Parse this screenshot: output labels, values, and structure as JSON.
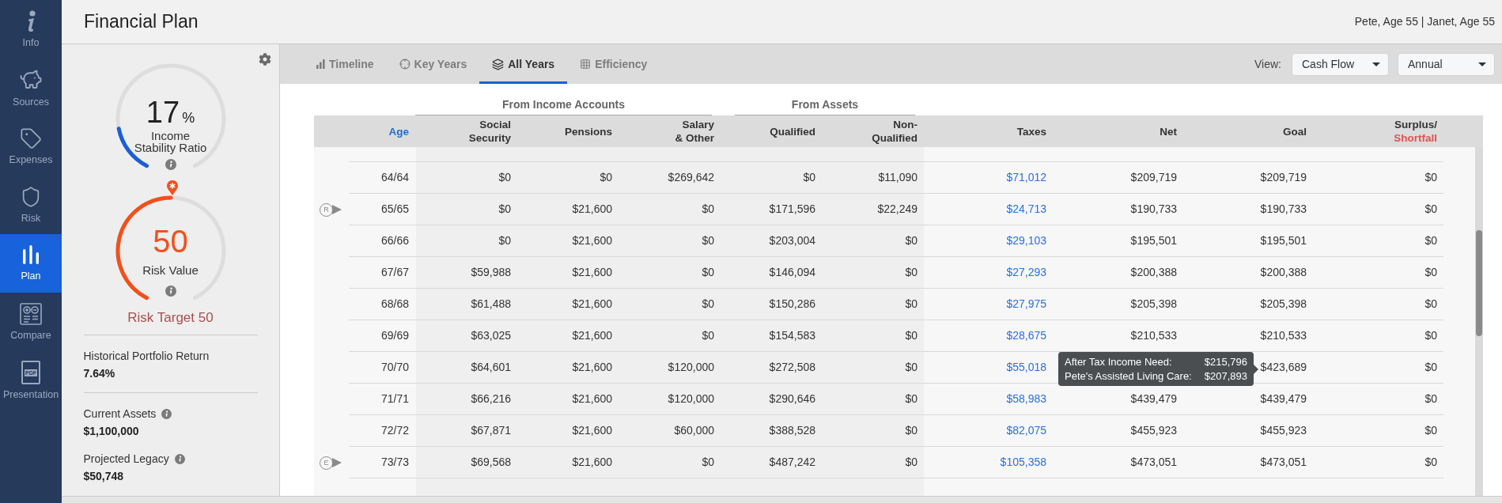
{
  "nav": {
    "items": [
      {
        "label": "Info",
        "selected": false
      },
      {
        "label": "Sources",
        "selected": false
      },
      {
        "label": "Expenses",
        "selected": false
      },
      {
        "label": "Risk",
        "selected": false
      },
      {
        "label": "Plan",
        "selected": true
      },
      {
        "label": "Compare",
        "selected": false
      },
      {
        "label": "Presentation",
        "selected": false,
        "icon_text": "PDF"
      }
    ]
  },
  "header": {
    "title": "Financial Plan",
    "clients": "Pete, Age 55 | Janet, Age 55"
  },
  "summary": {
    "income_stability": {
      "value": "17",
      "unit": "%",
      "label_lines": [
        "Income",
        "Stability Ratio"
      ],
      "level": 0.17
    },
    "risk": {
      "value": "50",
      "label": "Risk Value",
      "level": 0.5
    },
    "risk_target": "Risk Target 50",
    "stat_groups": [
      [
        {
          "label": "Historical Portfolio Return",
          "value": "7.64%",
          "info": false
        }
      ],
      [
        {
          "label": "Current Assets",
          "value": "$1,100,000",
          "info": true
        },
        {
          "label": "Projected Legacy",
          "value": "$50,748",
          "info": true
        }
      ]
    ]
  },
  "tabs": [
    {
      "label": "Timeline",
      "selected": false
    },
    {
      "label": "Key Years",
      "selected": false
    },
    {
      "label": "All Years",
      "selected": true
    },
    {
      "label": "Efficiency",
      "selected": false
    }
  ],
  "view": {
    "label": "View:",
    "selects": [
      {
        "value": "Cash Flow"
      },
      {
        "value": "Annual"
      }
    ]
  },
  "table": {
    "groups": [
      {
        "label": "From Income Accounts"
      },
      {
        "label": "From Assets"
      }
    ],
    "columns": [
      {
        "lines": [
          "Age"
        ],
        "kind": "accent"
      },
      {
        "lines": [
          "Social",
          "Security"
        ],
        "kind": "plain"
      },
      {
        "lines": [
          "Pensions"
        ],
        "kind": "plain"
      },
      {
        "lines": [
          "Salary",
          "& Other"
        ],
        "kind": "plain"
      },
      {
        "lines": [
          "Qualified"
        ],
        "kind": "plain"
      },
      {
        "lines": [
          "Non-",
          "Qualified"
        ],
        "kind": "plain"
      },
      {
        "lines": [
          "Taxes"
        ],
        "kind": "link"
      },
      {
        "lines": [
          "Net"
        ],
        "kind": "plain"
      },
      {
        "lines": [
          "Goal"
        ],
        "kind": "plain"
      },
      {
        "lines": [
          "Surplus/"
        ],
        "negative_label": "Shortfall",
        "kind": "plain"
      }
    ],
    "rows": [
      {
        "cells": [
          "64/64",
          "$0",
          "$0",
          "$269,642",
          "$0",
          "$11,090",
          "$71,012",
          "$209,719",
          "$209,719",
          "$0"
        ]
      },
      {
        "cells": [
          "65/65",
          "$0",
          "$21,600",
          "$0",
          "$171,596",
          "$22,249",
          "$24,713",
          "$190,733",
          "$190,733",
          "$0"
        ],
        "marker": "R"
      },
      {
        "cells": [
          "66/66",
          "$0",
          "$21,600",
          "$0",
          "$203,004",
          "$0",
          "$29,103",
          "$195,501",
          "$195,501",
          "$0"
        ]
      },
      {
        "cells": [
          "67/67",
          "$59,988",
          "$21,600",
          "$0",
          "$146,094",
          "$0",
          "$27,293",
          "$200,388",
          "$200,388",
          "$0"
        ]
      },
      {
        "cells": [
          "68/68",
          "$61,488",
          "$21,600",
          "$0",
          "$150,286",
          "$0",
          "$27,975",
          "$205,398",
          "$205,398",
          "$0"
        ]
      },
      {
        "cells": [
          "69/69",
          "$63,025",
          "$21,600",
          "$0",
          "$154,583",
          "$0",
          "$28,675",
          "$210,533",
          "$210,533",
          "$0"
        ]
      },
      {
        "cells": [
          "70/70",
          "$64,601",
          "$21,600",
          "$120,000",
          "$272,508",
          "$0",
          "$55,018",
          null,
          "$423,689",
          "$0"
        ],
        "tooltip": {
          "rows": [
            {
              "label": "After Tax Income Need:",
              "value": "$215,796"
            },
            {
              "label": "Pete's Assisted Living Care:",
              "value": "$207,893"
            }
          ]
        }
      },
      {
        "cells": [
          "71/71",
          "$66,216",
          "$21,600",
          "$120,000",
          "$290,646",
          "$0",
          "$58,983",
          "$439,479",
          "$439,479",
          "$0"
        ]
      },
      {
        "cells": [
          "72/72",
          "$67,871",
          "$21,600",
          "$60,000",
          "$388,528",
          "$0",
          "$82,075",
          "$455,923",
          "$455,923",
          "$0"
        ]
      },
      {
        "cells": [
          "73/73",
          "$69,568",
          "$21,600",
          "$0",
          "$487,242",
          "$0",
          "$105,358",
          "$473,051",
          "$473,051",
          "$0"
        ],
        "marker": "E"
      }
    ]
  }
}
